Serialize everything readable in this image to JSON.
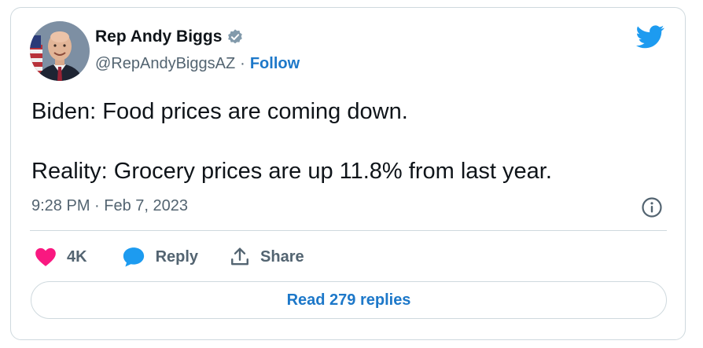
{
  "author": {
    "name": "Rep Andy Biggs",
    "handle": "@RepAndyBiggsAZ",
    "separator": "·",
    "follow_label": "Follow",
    "verified": true
  },
  "tweet": {
    "line1": "Biden: Food prices are coming down.",
    "line2": "Reality: Grocery prices are up 11.8% from last year.",
    "timestamp": "9:28 PM · Feb 7, 2023"
  },
  "actions": {
    "like_count": "4K",
    "reply_label": "Reply",
    "share_label": "Share"
  },
  "replies_button": {
    "label": "Read 279 replies"
  },
  "icons": {
    "brand": "twitter-bird-icon",
    "verified": "verified-badge-icon",
    "info": "info-icon",
    "like": "heart-icon",
    "reply": "speech-bubble-icon",
    "share": "share-upload-icon"
  },
  "colors": {
    "link": "#1d78c9",
    "twitter_blue": "#1d9bf0",
    "like_pink": "#f91880",
    "muted_text": "#536471",
    "border": "#cfd9de"
  }
}
